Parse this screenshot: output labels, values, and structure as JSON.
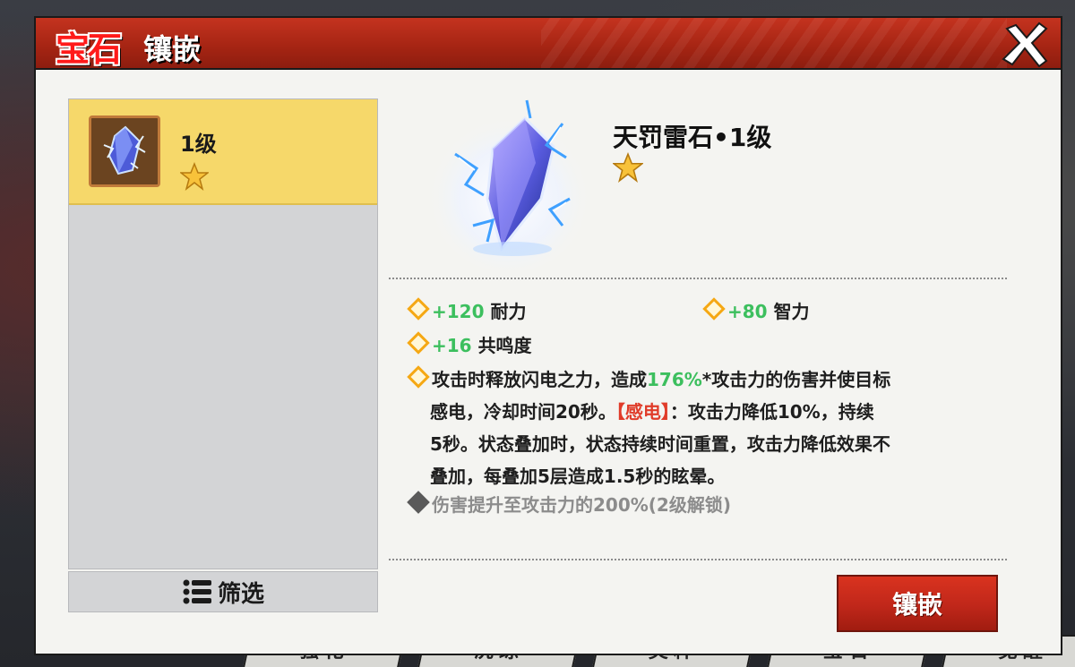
{
  "window": {
    "title_red": "宝石",
    "title_white": "镶嵌"
  },
  "background_tabs": [
    "强化",
    "洗练",
    "灵粹",
    "宝石",
    "觉醒"
  ],
  "gem_list": {
    "items": [
      {
        "level": "1级",
        "stars": 1,
        "selected": true
      }
    ],
    "filter_label": "筛选"
  },
  "gem_detail": {
    "name": "天罚雷石•1级",
    "stars": 1,
    "stats": [
      {
        "value": "+120",
        "label": "耐力"
      },
      {
        "value": "+80",
        "label": "智力"
      },
      {
        "value": "+16",
        "label": "共鸣度"
      }
    ],
    "effect": {
      "part1": "攻击时释放闪电之力，造成",
      "percent": "176%",
      "part2": "*攻击力的伤害并使目标",
      "line2_start": "感电，冷却时间20秒。",
      "keyword": "【感电】",
      "line2_end": "：攻击力降低10%，持续",
      "line3": "5秒。状态叠加时，状态持续时间重置，攻击力降低效果不",
      "line4": "叠加，每叠加5层造成1.5秒的眩晕。"
    },
    "locked_effect": "伤害提升至攻击力的200%(2级解锁)"
  },
  "inlay_button_label": "镶嵌",
  "colors": {
    "header_red": "#b0291a",
    "selected_yellow": "#f6d86a",
    "stat_green": "#3cbf5e",
    "keyword_red": "#e03c2a",
    "diamond_orange": "#f5a814"
  }
}
